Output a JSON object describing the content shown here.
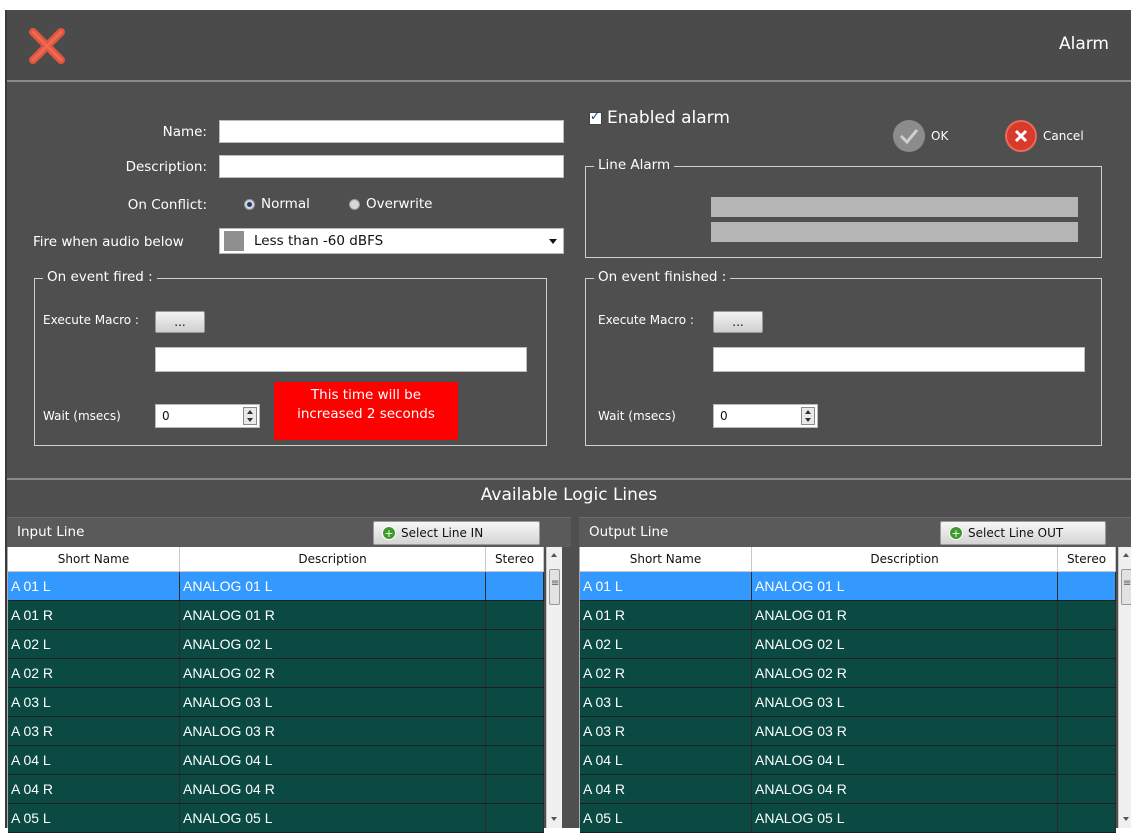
{
  "window": {
    "title": "Alarm"
  },
  "form": {
    "name_label": "Name:",
    "name_value": "",
    "description_label": "Description:",
    "description_value": "",
    "on_conflict_label": "On Conflict:",
    "conflict_options": [
      "Normal",
      "Overwrite"
    ],
    "conflict_selected": "Normal",
    "fire_label": "Fire when audio below",
    "fire_value": "Less than -60 dBFS",
    "enabled_label": "Enabled alarm",
    "enabled": true,
    "ok_label": "OK",
    "cancel_label": "Cancel",
    "line_alarm_title": "Line Alarm"
  },
  "event_fired": {
    "title": "On event fired :",
    "macro_label": "Execute Macro :",
    "macro_button": "...",
    "macro_value": "",
    "wait_label": "Wait (msecs)",
    "wait_value": "0",
    "note_line1": "This time will be",
    "note_line2": "increased 2 seconds"
  },
  "event_finished": {
    "title": "On event finished :",
    "macro_label": "Execute Macro :",
    "macro_button": "...",
    "macro_value": "",
    "wait_label": "Wait (msecs)",
    "wait_value": "0"
  },
  "logic": {
    "header": "Available Logic Lines",
    "columns": [
      "Short Name",
      "Description",
      "Stereo"
    ],
    "input": {
      "title": "Input Line",
      "select_label": "Select  Line IN"
    },
    "output": {
      "title": "Output Line",
      "select_label": "Select  Line OUT"
    },
    "rows": [
      {
        "short": "A 01 L",
        "desc": "ANALOG 01 L",
        "stereo": ""
      },
      {
        "short": "A 01 R",
        "desc": "ANALOG 01 R",
        "stereo": ""
      },
      {
        "short": "A 02 L",
        "desc": "ANALOG 02 L",
        "stereo": ""
      },
      {
        "short": "A 02 R",
        "desc": "ANALOG 02 R",
        "stereo": ""
      },
      {
        "short": "A 03 L",
        "desc": "ANALOG 03 L",
        "stereo": ""
      },
      {
        "short": "A 03 R",
        "desc": "ANALOG 03 R",
        "stereo": ""
      },
      {
        "short": "A 04 L",
        "desc": "ANALOG 04 L",
        "stereo": ""
      },
      {
        "short": "A 04 R",
        "desc": "ANALOG 04 R",
        "stereo": ""
      },
      {
        "short": "A 05 L",
        "desc": "ANALOG 05 L",
        "stereo": ""
      }
    ],
    "selected_row": 0
  },
  "colors": {
    "window_bg": "#4f4f4f",
    "row_bg": "#0b4a43",
    "row_selected": "#3399ff",
    "note_bg": "#ff0000",
    "close_x": "#e2553f"
  },
  "icons": {
    "close": "close-x-icon",
    "ok": "checkmark-icon",
    "cancel": "cancel-icon",
    "add": "plus-icon"
  }
}
